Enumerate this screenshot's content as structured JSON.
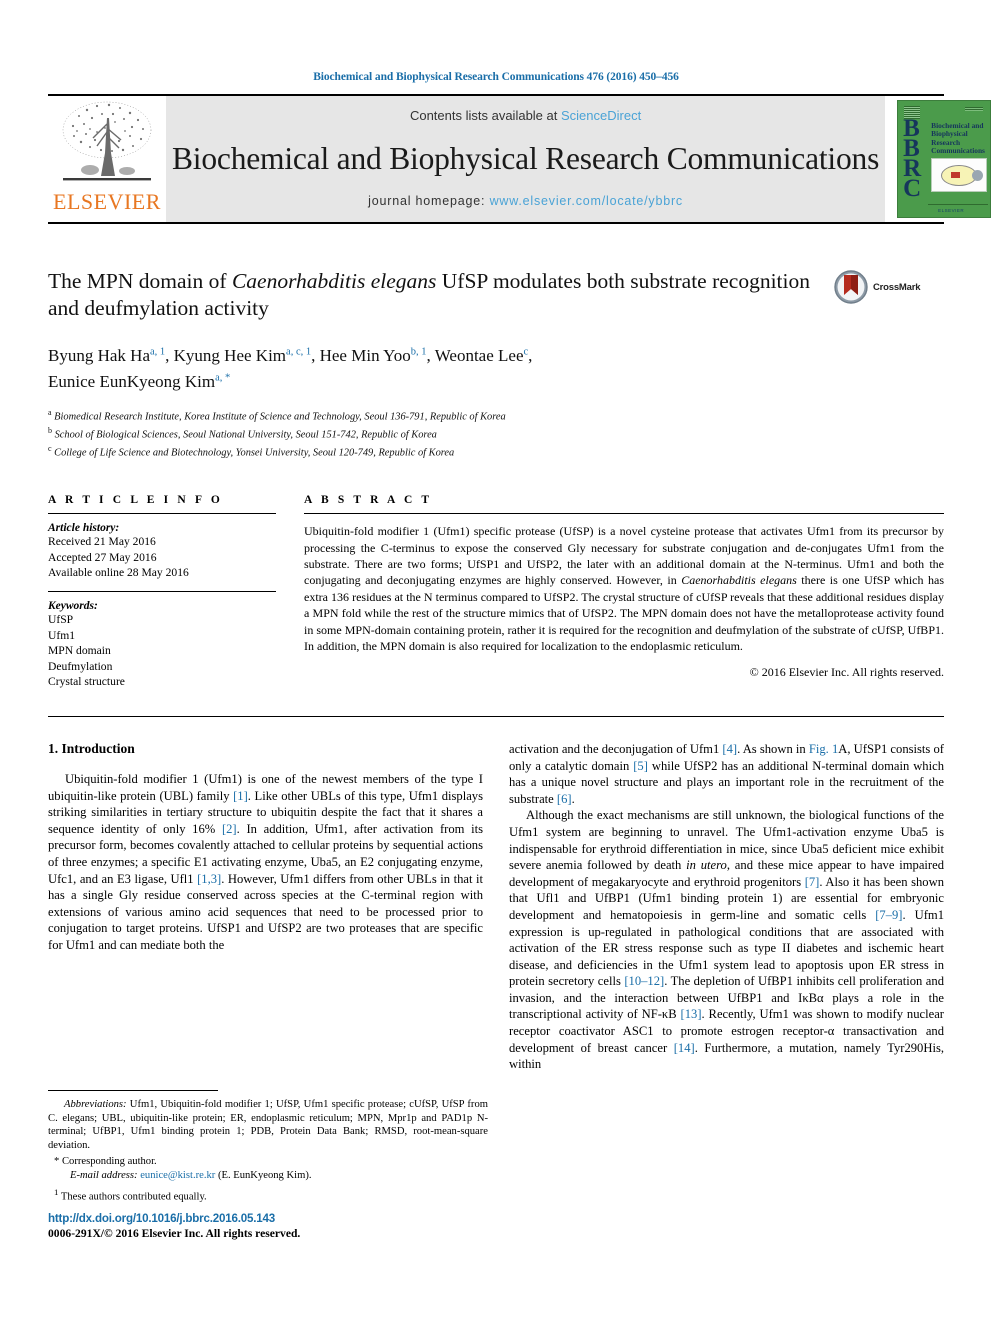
{
  "running_head": "Biochemical and Biophysical Research Communications 476 (2016) 450–456",
  "masthead": {
    "publisher_name": "ELSEVIER",
    "contents_prefix": "Contents lists available at ",
    "contents_link": "ScienceDirect",
    "journal_title": "Biochemical and Biophysical Research Communications",
    "homepage_prefix": "journal homepage: ",
    "homepage_url": "www.elsevier.com/locate/ybbrc",
    "cover": {
      "acronym_letters": "BBRC",
      "cover_title": "Biochemical and Biophysical Research Communications",
      "cover_footer": "ELSEVIER"
    },
    "colors": {
      "link_blue": "#4aa3d6",
      "elsevier_orange": "#E87722",
      "band_gray": "#e6e6e6",
      "cover_green": "#4b9b4b"
    }
  },
  "article": {
    "title_part1": "The MPN domain of ",
    "title_italic": "Caenorhabditis elegans",
    "title_part2": " UfSP modulates both substrate recognition and deufmylation activity",
    "crossmark_label": "CrossMark",
    "authors": [
      {
        "name": "Byung Hak Ha",
        "marks": "a, 1",
        "sep": ", "
      },
      {
        "name": "Kyung Hee Kim",
        "marks": "a, c, 1",
        "sep": ", "
      },
      {
        "name": "Hee Min Yoo",
        "marks": "b, 1",
        "sep": ", "
      },
      {
        "name": "Weontae Lee",
        "marks": "c",
        "sep": ","
      },
      {
        "name": "Eunice EunKyeong Kim",
        "marks": "a, *",
        "sep": ""
      }
    ],
    "affiliations": [
      {
        "mark": "a",
        "text": "Biomedical Research Institute, Korea Institute of Science and Technology, Seoul 136-791, Republic of Korea"
      },
      {
        "mark": "b",
        "text": "School of Biological Sciences, Seoul National University, Seoul 151-742, Republic of Korea"
      },
      {
        "mark": "c",
        "text": "College of Life Science and Biotechnology, Yonsei University, Seoul 120-749, Republic of Korea"
      }
    ]
  },
  "article_info": {
    "heading": "A R T I C L E  I N F O",
    "history_label": "Article history:",
    "history": [
      "Received 21 May 2016",
      "Accepted 27 May 2016",
      "Available online 28 May 2016"
    ],
    "keywords_label": "Keywords:",
    "keywords": [
      "UfSP",
      "Ufm1",
      "MPN domain",
      "Deufmylation",
      "Crystal structure"
    ]
  },
  "abstract": {
    "heading": "A B S T R A C T",
    "text_before_italic": "Ubiquitin-fold modifier 1 (Ufm1) specific protease (UfSP) is a novel cysteine protease that activates Ufm1 from its precursor by processing the C-terminus to expose the conserved Gly necessary for substrate conjugation and de-conjugates Ufm1 from the substrate. There are two forms; UfSP1 and UfSP2, the later with an additional domain at the N-terminus. Ufm1 and both the conjugating and deconjugating enzymes are highly conserved. However, in ",
    "italic_species": "Caenorhabditis elegans",
    "text_after_italic": " there is one UfSP which has extra 136 residues at the N terminus compared to UfSP2. The crystal structure of cUfSP reveals that these additional residues display a MPN fold while the rest of the structure mimics that of UfSP2. The MPN domain does not have the metalloprotease activity found in some MPN-domain containing protein, rather it is required for the recognition and deufmylation of the substrate of cUfSP, UfBP1. In addition, the MPN domain is also required for localization to the endoplasmic reticulum.",
    "copyright": "© 2016 Elsevier Inc. All rights reserved."
  },
  "body": {
    "section_title": "1. Introduction",
    "left_paragraphs": [
      "Ubiquitin-fold modifier 1 (Ufm1) is one of the newest members of the type I ubiquitin-like protein (UBL) family [1]. Like other UBLs of this type, Ufm1 displays striking similarities in tertiary structure to ubiquitin despite the fact that it shares a sequence identity of only 16% [2]. In addition, Ufm1, after activation from its precursor form, becomes covalently attached to cellular proteins by sequential actions of three enzymes; a specific E1 activating enzyme, Uba5, an E2 conjugating enzyme, Ufc1, and an E3 ligase, Ufl1 [1,3]. However, Ufm1 differs from other UBLs in that it has a single Gly residue conserved across species at the C-terminal region with extensions of various amino acid sequences that need to be processed prior to conjugation to target proteins. UfSP1 and UfSP2 are two proteases that are specific for Ufm1 and can mediate both the"
    ],
    "right_paragraphs": [
      "activation and the deconjugation of Ufm1 [4]. As shown in Fig. 1A, UfSP1 consists of only a catalytic domain [5] while UfSP2 has an additional N-terminal domain which has a unique novel structure and plays an important role in the recruitment of the substrate [6].",
      "Although the exact mechanisms are still unknown, the biological functions of the Ufm1 system are beginning to unravel. The Ufm1-activation enzyme Uba5 is indispensable for erythroid differentiation in mice, since Uba5 deficient mice exhibit severe anemia followed by death in utero, and these mice appear to have impaired development of megakaryocyte and erythroid progenitors [7]. Also it has been shown that Ufl1 and UfBP1 (Ufm1 binding protein 1) are essential for embryonic development and hematopoiesis in germ-line and somatic cells [7–9]. Ufm1 expression is up-regulated in pathological conditions that are associated with activation of the ER stress response such as type II diabetes and ischemic heart disease, and deficiencies in the Ufm1 system lead to apoptosis upon ER stress in protein secretory cells [10–12]. The depletion of UfBP1 inhibits cell proliferation and invasion, and the interaction between UfBP1 and IκBα plays a role in the transcriptional activity of NF-κB [13]. Recently, Ufm1 was shown to modify nuclear receptor coactivator ASC1 to promote estrogen receptor-α transactivation and development of breast cancer [14]. Furthermore, a mutation, namely Tyr290His, within"
    ]
  },
  "footnotes": {
    "abbreviations_label": "Abbreviations:",
    "abbreviations_text": " Ufm1, Ubiquitin-fold modifier 1; UfSP, Ufm1 specific protease; cUfSP, UfSP from C. elegans; UBL, ubiquitin-like protein; ER, endoplasmic reticulum; MPN, Mpr1p and PAD1p N-terminal; UfBP1, Ufm1 binding protein 1; PDB, Protein Data Bank; RMSD, root-mean-square deviation.",
    "corresponding_mark": "*",
    "corresponding_text": "Corresponding author.",
    "email_label": "E-mail address:",
    "email": "eunice@kist.re.kr",
    "email_suffix": " (E. EunKyeong Kim).",
    "equal_mark": "1",
    "equal_text": "These authors contributed equally."
  },
  "footer": {
    "doi": "http://dx.doi.org/10.1016/j.bbrc.2016.05.143",
    "issn_line": "0006-291X/© 2016 Elsevier Inc. All rights reserved."
  }
}
